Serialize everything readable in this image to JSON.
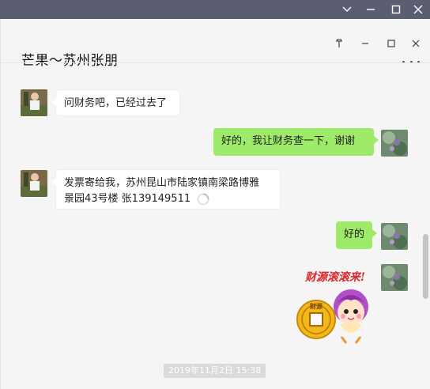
{
  "window": {
    "title": "芒果～苏州张朋",
    "pin_glyph": "🖈"
  },
  "messages": [
    {
      "side": "left",
      "text": "问财务吧，已经过去了"
    },
    {
      "side": "right",
      "text": "好的，我让财务查一下，谢谢"
    },
    {
      "side": "left",
      "line1": "发票寄给我，苏州昆山市陆家镇南梁路博雅",
      "line2": "景园43号楼 张139149511"
    },
    {
      "side": "right",
      "text": "好的"
    },
    {
      "side": "right",
      "sticker_text": "财源滚滚来!",
      "sticker_coin_text": "财源"
    }
  ],
  "timestamp": "2019年11月2日 15:38",
  "colors": {
    "outer_bar": "#5b5d72",
    "bubble_self": "#9eea6a",
    "bubble_other": "#ffffff",
    "background": "#f5f5f5"
  }
}
